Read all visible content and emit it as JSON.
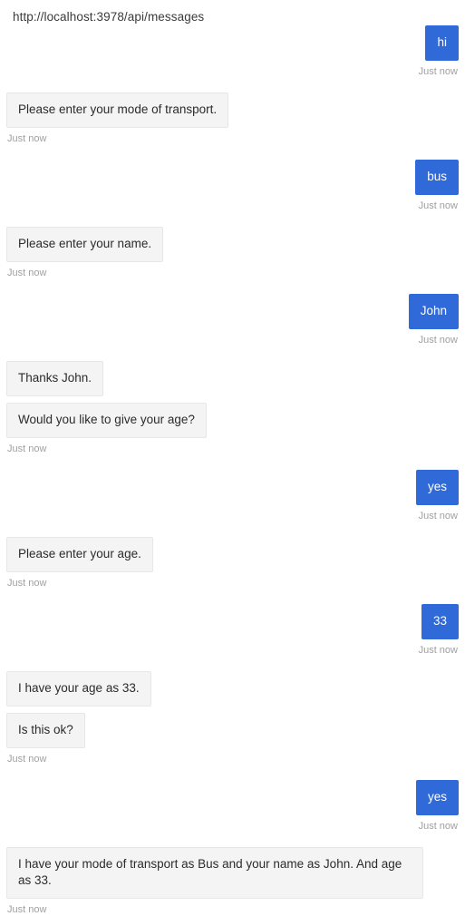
{
  "header": {
    "endpoint_url": "http://localhost:3978/api/messages"
  },
  "conversation": {
    "groups": [
      {
        "from": "user",
        "messages": [
          "hi"
        ],
        "timestamp": "Just now"
      },
      {
        "from": "bot",
        "messages": [
          "Please enter your mode of transport."
        ],
        "timestamp": "Just now"
      },
      {
        "from": "user",
        "messages": [
          "bus"
        ],
        "timestamp": "Just now"
      },
      {
        "from": "bot",
        "messages": [
          "Please enter your name."
        ],
        "timestamp": "Just now"
      },
      {
        "from": "user",
        "messages": [
          "John"
        ],
        "timestamp": "Just now"
      },
      {
        "from": "bot",
        "messages": [
          "Thanks John.",
          "Would you like to give your age?"
        ],
        "timestamp": "Just now"
      },
      {
        "from": "user",
        "messages": [
          "yes"
        ],
        "timestamp": "Just now"
      },
      {
        "from": "bot",
        "messages": [
          "Please enter your age."
        ],
        "timestamp": "Just now"
      },
      {
        "from": "user",
        "messages": [
          "33"
        ],
        "timestamp": "Just now"
      },
      {
        "from": "bot",
        "messages": [
          "I have your age as 33.",
          "Is this ok?"
        ],
        "timestamp": "Just now"
      },
      {
        "from": "user",
        "messages": [
          "yes"
        ],
        "timestamp": "Just now"
      },
      {
        "from": "bot",
        "messages": [
          "I have your mode of transport as Bus and your name as John. And age as 33."
        ],
        "timestamp": "Just now"
      }
    ]
  },
  "colors": {
    "user_bubble": "#2f6ad8",
    "user_text": "#ffffff",
    "bot_bubble": "#f4f4f4",
    "bot_border": "#e7e7e7",
    "bot_text": "#2b2b2b",
    "timestamp_text": "#a0a0a0",
    "background": "#ffffff"
  }
}
